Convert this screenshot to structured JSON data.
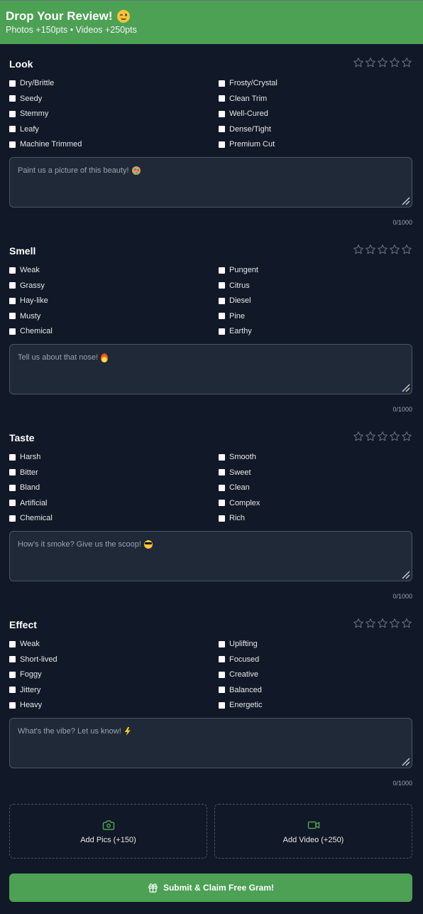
{
  "header": {
    "title": "Drop Your Review!",
    "title_emoji": "wink-face-icon",
    "subtitle": "Photos +150pts • Videos +250pts"
  },
  "sections": [
    {
      "title": "Look",
      "rating": 0,
      "max_rating": 5,
      "left_options": [
        "Dry/Brittle",
        "Seedy",
        "Stemmy",
        "Leafy",
        "Machine Trimmed"
      ],
      "right_options": [
        "Frosty/Crystal",
        "Clean Trim",
        "Well-Cured",
        "Dense/Tight",
        "Premium Cut"
      ],
      "placeholder": "Paint us a picture of this beauty!",
      "placeholder_emoji": "palette-emoji",
      "counter": "0/1000"
    },
    {
      "title": "Smell",
      "rating": 0,
      "max_rating": 5,
      "left_options": [
        "Weak",
        "Grassy",
        "Hay-like",
        "Musty",
        "Chemical"
      ],
      "right_options": [
        "Pungent",
        "Citrus",
        "Diesel",
        "Pine",
        "Earthy"
      ],
      "placeholder": "Tell us about that nose!",
      "placeholder_emoji": "fire-emoji",
      "counter": "0/1000"
    },
    {
      "title": "Taste",
      "rating": 0,
      "max_rating": 5,
      "left_options": [
        "Harsh",
        "Bitter",
        "Bland",
        "Artificial",
        "Chemical"
      ],
      "right_options": [
        "Smooth",
        "Sweet",
        "Clean",
        "Complex",
        "Rich"
      ],
      "placeholder": "How's it smoke? Give us the scoop!",
      "placeholder_emoji": "sunglasses-emoji",
      "counter": "0/1000"
    },
    {
      "title": "Effect",
      "rating": 0,
      "max_rating": 5,
      "left_options": [
        "Weak",
        "Short-lived",
        "Foggy",
        "Jittery",
        "Heavy"
      ],
      "right_options": [
        "Uplifting",
        "Focused",
        "Creative",
        "Balanced",
        "Energetic"
      ],
      "placeholder": "What's the vibe? Let us know!",
      "placeholder_emoji": "lightning-emoji",
      "counter": "0/1000"
    }
  ],
  "uploads": {
    "pics_label": "Add Pics (+150)",
    "pics_icon": "camera-icon",
    "video_label": "Add Video (+250)",
    "video_icon": "video-camera-icon"
  },
  "submit": {
    "label": "Submit & Claim Free Gram!",
    "icon": "gift-icon"
  },
  "colors": {
    "brand_green": "#4ca154",
    "background": "#111827",
    "input_bg": "#1f2937",
    "border": "#4b5563",
    "muted_text": "#9ca3af"
  }
}
